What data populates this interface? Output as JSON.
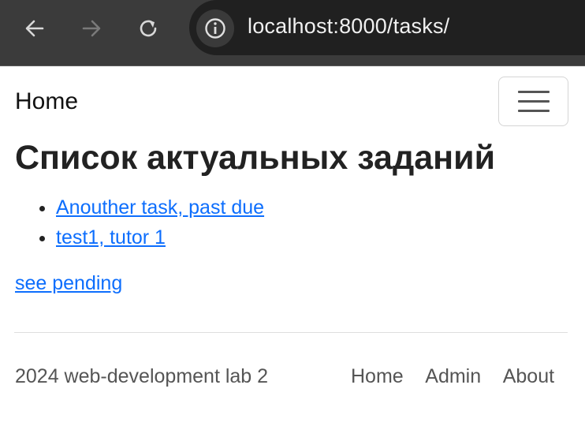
{
  "browser": {
    "url": "localhost:8000/tasks/",
    "icons": {
      "back": "arrow-left-icon",
      "forward": "arrow-right-icon",
      "reload": "reload-icon",
      "info": "info-icon"
    }
  },
  "navbar": {
    "brand": "Home",
    "toggler_icon": "hamburger-icon"
  },
  "main": {
    "title": "Список актуальных заданий",
    "tasks": [
      {
        "label": "Anouther task, past due"
      },
      {
        "label": "test1, tutor 1"
      }
    ],
    "pending_link": "see pending"
  },
  "footer": {
    "text": "2024 web-development lab 2",
    "links": [
      {
        "label": "Home"
      },
      {
        "label": "Admin"
      },
      {
        "label": "About"
      }
    ]
  },
  "colors": {
    "link": "#0d6efd",
    "chrome_bg": "#3b3b3b",
    "urlbar_bg": "#202020"
  }
}
